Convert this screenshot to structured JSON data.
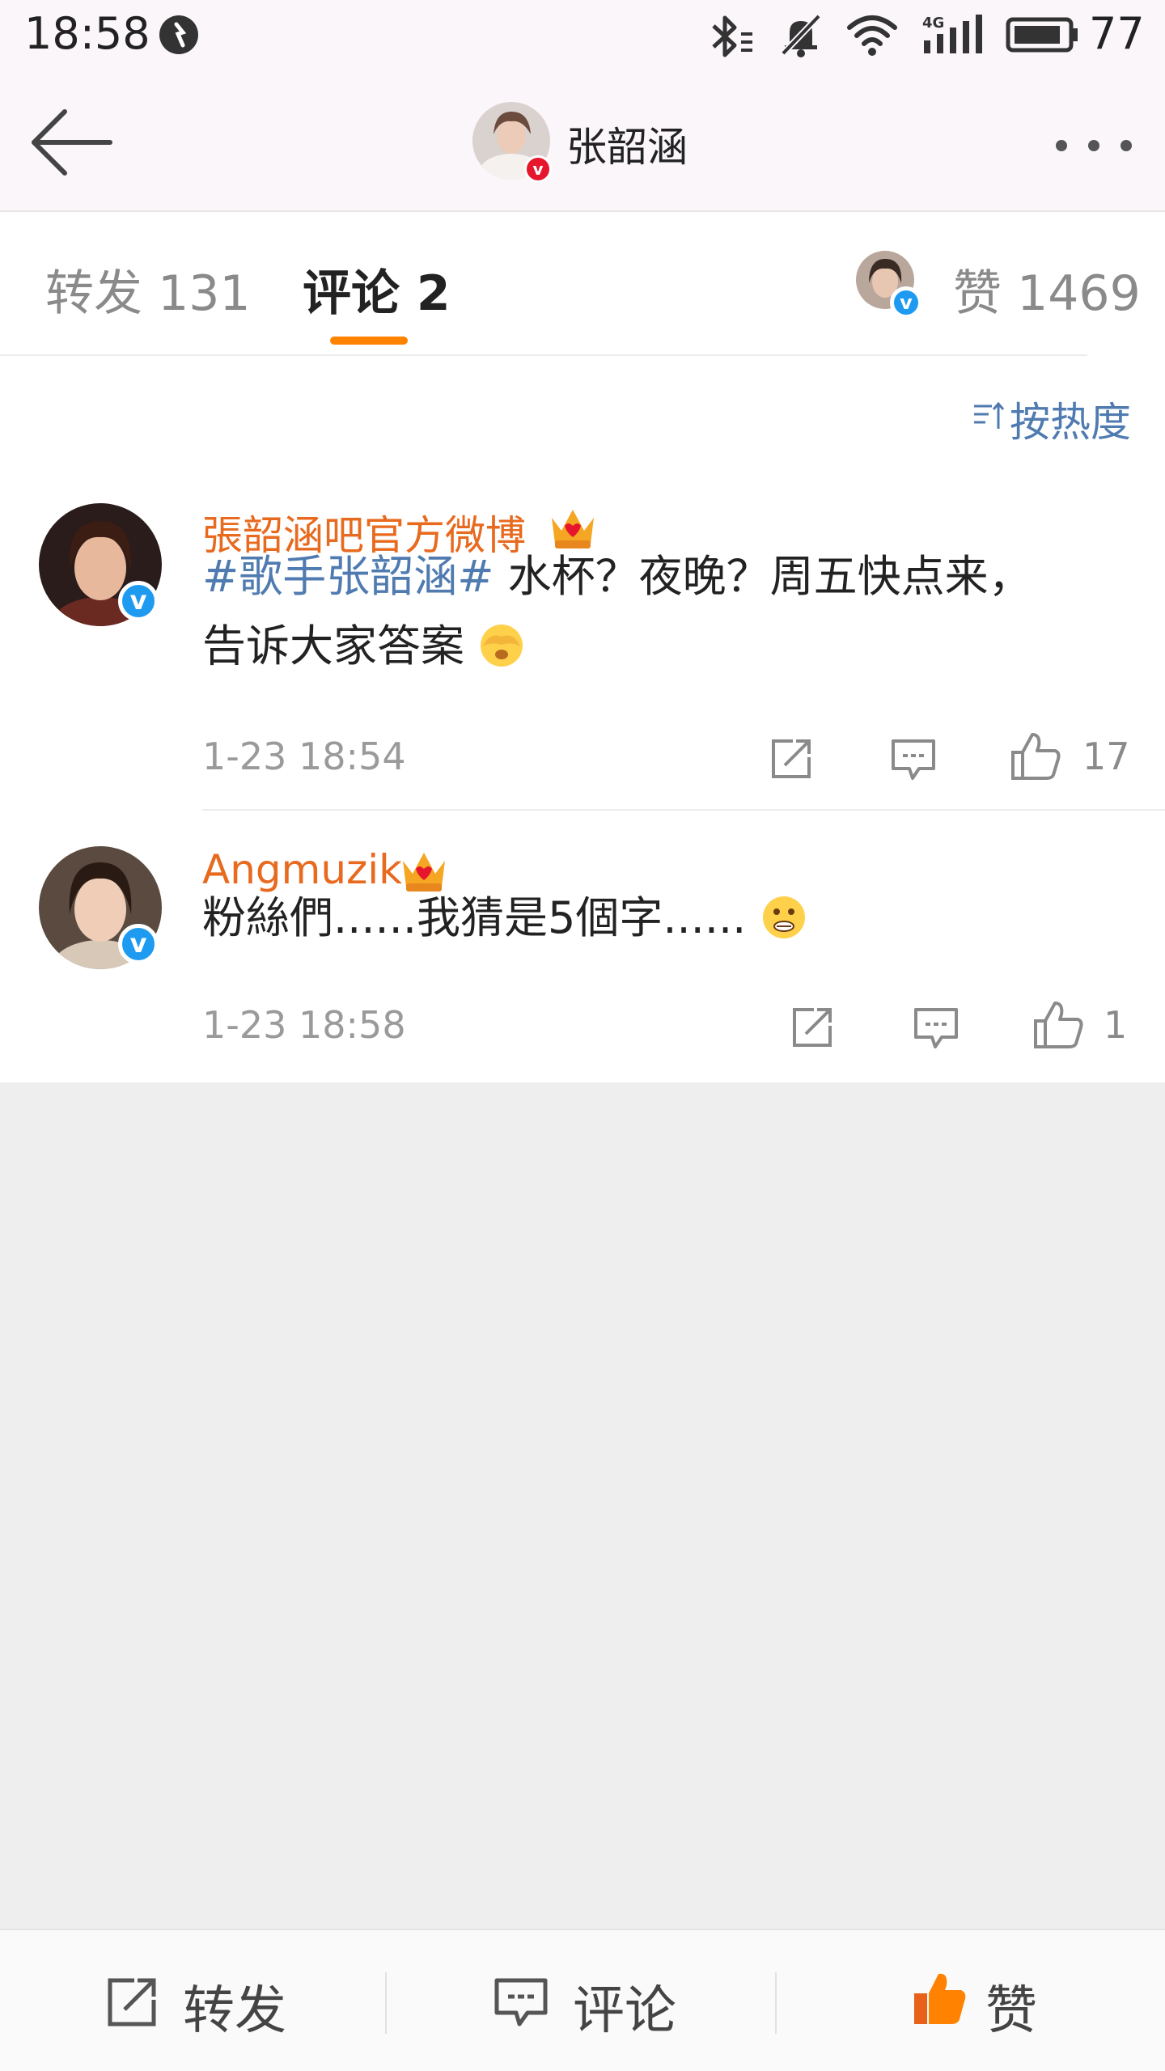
{
  "status_bar": {
    "time": "18:58",
    "battery_level": "77",
    "icons": [
      "notification-icon",
      "bluetooth-icon",
      "mute-icon",
      "wifi-icon",
      "signal-4g-icon",
      "battery-icon"
    ]
  },
  "header": {
    "title": "张韶涵",
    "back_icon": "back-arrow-icon",
    "more_icon": "more-dots-icon"
  },
  "tabs": [
    {
      "label": "转发 131",
      "active": false
    },
    {
      "label": "评论 2",
      "active": true
    }
  ],
  "likes_tab": {
    "label": "赞 1469"
  },
  "sort": {
    "label": "按热度"
  },
  "comments": [
    {
      "username": "張韶涵吧官方微博",
      "hashtag": "#歌手张韶涵#",
      "text_line1": " 水杯？夜晚？周五快点来，",
      "text_line2": "告诉大家答案",
      "time": "1-23 18:54",
      "likes": "17"
    },
    {
      "username": "Angmuzik",
      "hashtag": "",
      "text_line1": "粉絲們......我猜是5個字......",
      "text_line2": "",
      "time": "1-23 18:58",
      "likes": "1"
    }
  ],
  "bottom_bar": {
    "repost": "转发",
    "comment": "评论",
    "like": "赞"
  },
  "colors": {
    "accent": "#ff8200",
    "username": "#e86a1f",
    "link": "#4f7bb0",
    "verified": "#1e9bf0"
  }
}
